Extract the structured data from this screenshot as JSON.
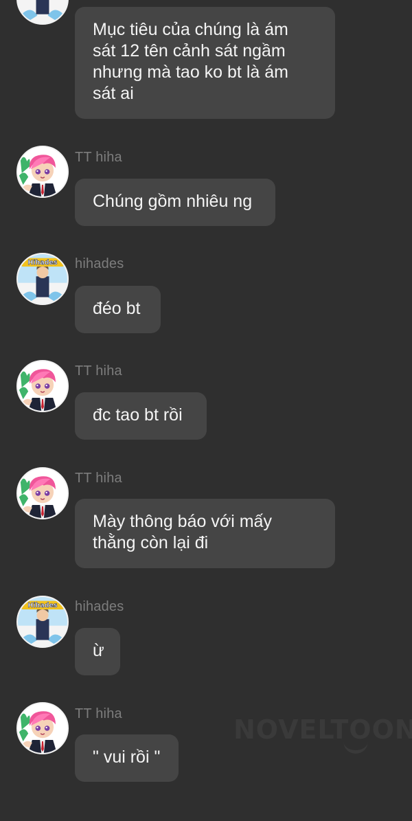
{
  "watermark": "NOVELTOON",
  "messages": [
    {
      "sender": "",
      "avatar": "hihades-avatar",
      "text": "Mục tiêu của chúng là ám\nsát 12 tên cảnh sát ngầm\nnhưng mà tao ko bt là ám\nsát ai"
    },
    {
      "sender": "TT hiha",
      "avatar": "tt-hiha-avatar",
      "text": "Chúng gồm nhiêu ng"
    },
    {
      "sender": "hihades",
      "avatar": "hihades-avatar",
      "avatar_text": "Hihades",
      "text": "đéo bt"
    },
    {
      "sender": "TT hiha",
      "avatar": "tt-hiha-avatar",
      "text": "đc tao bt rồi"
    },
    {
      "sender": "TT hiha",
      "avatar": "tt-hiha-avatar",
      "text": "Mày thông báo với mấy\nthằng còn lại đi"
    },
    {
      "sender": "hihades",
      "avatar": "hihades-avatar",
      "avatar_text": "Hihades",
      "text": "ừ"
    },
    {
      "sender": "TT hiha",
      "avatar": "tt-hiha-avatar",
      "text": "\" vui rồi \""
    }
  ]
}
